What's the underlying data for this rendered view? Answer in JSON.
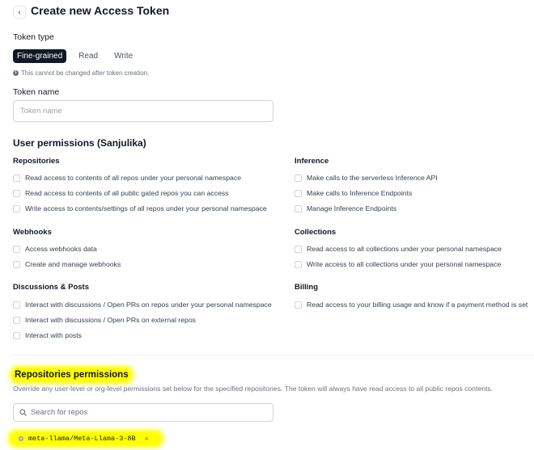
{
  "header": {
    "title": "Create new Access Token"
  },
  "token_type": {
    "label": "Token type",
    "options": [
      {
        "label": "Fine-grained",
        "selected": true
      },
      {
        "label": "Read",
        "selected": false
      },
      {
        "label": "Write",
        "selected": false
      }
    ],
    "note": "This cannot be changed after token creation."
  },
  "token_name": {
    "label": "Token name",
    "placeholder": "Token name",
    "value": ""
  },
  "user_permissions": {
    "heading": "User permissions (Sanjulika)",
    "groups": {
      "repositories": {
        "title": "Repositories",
        "items": [
          "Read access to contents of all repos under your personal namespace",
          "Read access to contents of all public gated repos you can access",
          "Write access to contents/settings of all repos under your personal namespace"
        ]
      },
      "inference": {
        "title": "Inference",
        "items": [
          "Make calls to the serverless Inference API",
          "Make calls to Inference Endpoints",
          "Manage Inference Endpoints"
        ]
      },
      "webhooks": {
        "title": "Webhooks",
        "items": [
          "Access webhooks data",
          "Create and manage webhooks"
        ]
      },
      "collections": {
        "title": "Collections",
        "items": [
          "Read access to all collections under your personal namespace",
          "Write access to all collections under your personal namespace"
        ]
      },
      "discussions": {
        "title": "Discussions & Posts",
        "items": [
          "Interact with discussions / Open PRs on repos under your personal namespace",
          "Interact with discussions / Open PRs on external repos",
          "Interact with posts"
        ]
      },
      "billing": {
        "title": "Billing",
        "items": [
          "Read access to your billing usage and know if a payment method is set"
        ]
      }
    }
  },
  "repo_permissions": {
    "title": "Repositories permissions",
    "description": "Override any user-level or org-level permissions set below for the specified repositories. The token will always have read access to all public repos contents.",
    "search_placeholder": "Search for repos",
    "selected_repo": "meta-llama/Meta-Llama-3-8B",
    "remove_symbol": "×"
  },
  "colors": {
    "highlight": "#ffff00",
    "primary_dark": "#111827"
  },
  "icons": [
    "back-arrow-icon",
    "info-icon",
    "search-icon",
    "repo-icon",
    "remove-icon"
  ]
}
